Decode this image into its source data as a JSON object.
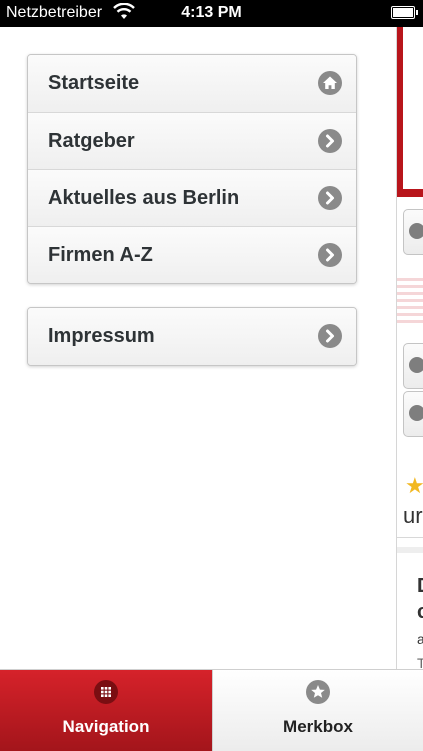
{
  "status_bar": {
    "carrier": "Netzbetreiber",
    "time": "4:13 PM"
  },
  "menu": {
    "group1": [
      {
        "label": "Startseite",
        "icon": "home-icon"
      },
      {
        "label": "Ratgeber",
        "icon": "chevron-right-icon"
      },
      {
        "label": "Aktuelles aus Berlin",
        "icon": "chevron-right-icon"
      },
      {
        "label": "Firmen A-Z",
        "icon": "chevron-right-icon"
      }
    ],
    "group2": [
      {
        "label": "Impressum",
        "icon": "chevron-right-icon"
      }
    ]
  },
  "content_peek": {
    "text1": "ur",
    "heading1": "D",
    "heading2": "c",
    "line1": "a",
    "line2": "T"
  },
  "tab_bar": {
    "tabs": [
      {
        "label": "Navigation",
        "icon": "grid-icon",
        "active": true
      },
      {
        "label": "Merkbox",
        "icon": "star-icon",
        "active": false
      }
    ]
  },
  "colors": {
    "accent_red": "#c41c22",
    "menu_text": "#2e3336",
    "icon_gray": "#8a8a8a"
  }
}
